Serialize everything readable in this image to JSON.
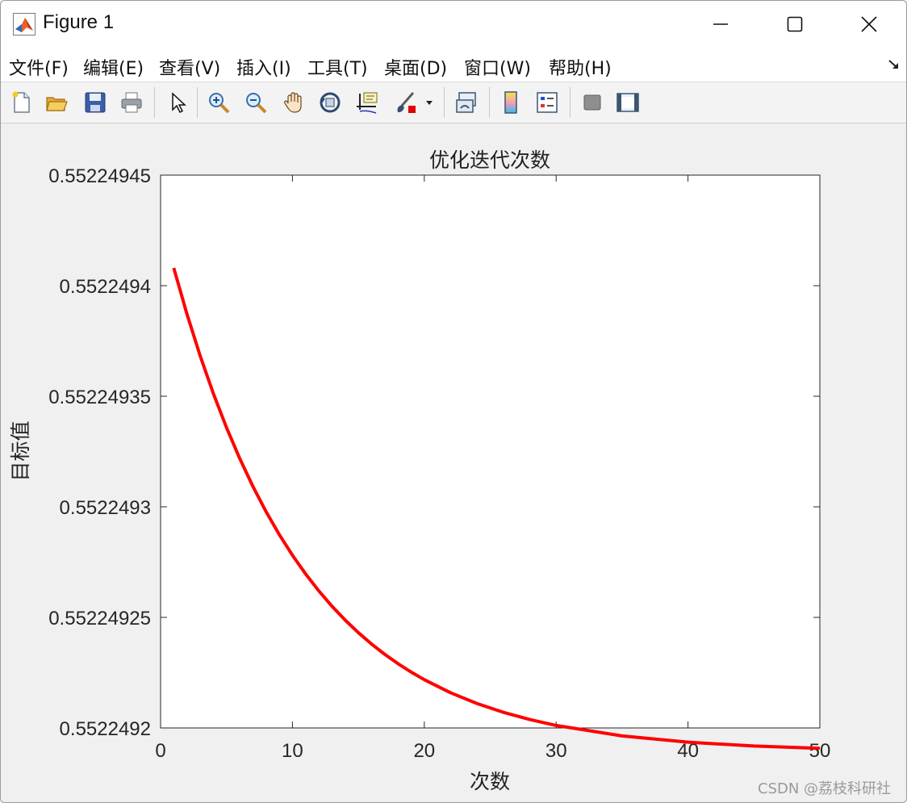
{
  "window": {
    "title": "Figure 1",
    "app_icon": "matlab-logo-icon",
    "controls": [
      "minimize-icon",
      "maximize-icon",
      "close-icon"
    ]
  },
  "menu": {
    "items": [
      {
        "label": "文件(F)"
      },
      {
        "label": "编辑(E)"
      },
      {
        "label": "查看(V)"
      },
      {
        "label": "插入(I)"
      },
      {
        "label": "工具(T)"
      },
      {
        "label": "桌面(D)"
      },
      {
        "label": "窗口(W)"
      },
      {
        "label": "帮助(H)"
      }
    ],
    "collapse_icon": "dock-arrow-icon"
  },
  "toolbar": {
    "buttons": [
      "new-figure-icon",
      "open-file-icon",
      "save-icon",
      "print-icon",
      "edit-plot-arrow-icon",
      "zoom-in-icon",
      "zoom-out-icon",
      "pan-hand-icon",
      "rotate-3d-icon",
      "data-cursor-icon",
      "brush-icon",
      "brush-dropdown-icon",
      "link-plot-icon",
      "colorbar-icon",
      "legend-icon",
      "hide-plot-tools-icon",
      "show-plot-tools-icon"
    ]
  },
  "chart_data": {
    "type": "line",
    "title": "优化迭代次数",
    "xlabel": "次数",
    "ylabel": "目标值",
    "xlim": [
      0,
      50
    ],
    "ylim": [
      0.5522492,
      0.55224945
    ],
    "xticks": [
      "0",
      "10",
      "20",
      "30",
      "40",
      "50"
    ],
    "yticks": [
      "0.5522492",
      "0.55224925",
      "0.5522493",
      "0.55224935",
      "0.5522494",
      "0.55224945"
    ],
    "grid": false,
    "series": [
      {
        "color": "#ff0000",
        "x": [
          1,
          2,
          3,
          4,
          5,
          6,
          7,
          8,
          9,
          10,
          11,
          12,
          13,
          14,
          15,
          16,
          17,
          18,
          19,
          20,
          22,
          24,
          26,
          28,
          30,
          35,
          40,
          45,
          50
        ],
        "y": [
          0.552249408,
          0.55224938717,
          0.55224936832,
          0.55224935127,
          0.55224933584,
          0.55224932188,
          0.55224930925,
          0.55224929781,
          0.55224928747,
          0.55224927811,
          0.55224926964,
          0.55224926198,
          0.55224925504,
          0.55224924877,
          0.55224924309,
          0.55224923795,
          0.5522492333,
          0.55224922909,
          0.55224922528,
          0.55224922183,
          0.5522492159,
          0.55224921104,
          0.55224920706,
          0.5522492038,
          0.55224920113,
          0.55224919641,
          0.55224919355,
          0.55224919182,
          0.55224919077
        ]
      }
    ]
  },
  "watermark": "CSDN @荔枝科研社"
}
